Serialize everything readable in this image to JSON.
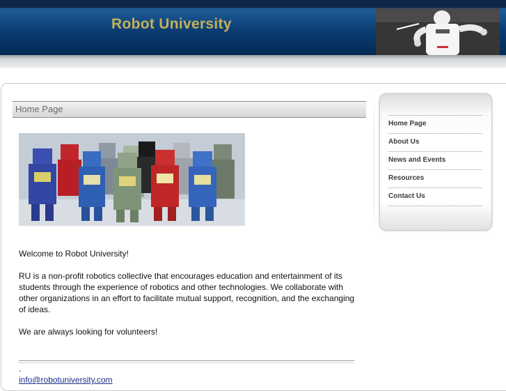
{
  "header": {
    "site_title": "Robot University"
  },
  "main": {
    "page_heading": "Home Page",
    "welcome_text": "Welcome to Robot University!",
    "about_text": "RU is a non-profit robotics collective that encourages education and entertainment of its students through the experience of robotics and other technologies. We collaborate with other organizations in an effort to facilitate mutual support, recognition, and the exchanging of ideas.",
    "volunteer_text": "We are always looking for volunteers!"
  },
  "footer": {
    "dot": ".",
    "email": "info@robotuniversity.com"
  },
  "nav": {
    "items": [
      {
        "label": "Home Page"
      },
      {
        "label": "About Us"
      },
      {
        "label": "News and Events"
      },
      {
        "label": "Resources"
      },
      {
        "label": "Contact Us"
      }
    ]
  },
  "colors": {
    "header_blue": "#0a3c72",
    "title_gold": "#c4b15a",
    "link_blue": "#1a2f8a"
  }
}
